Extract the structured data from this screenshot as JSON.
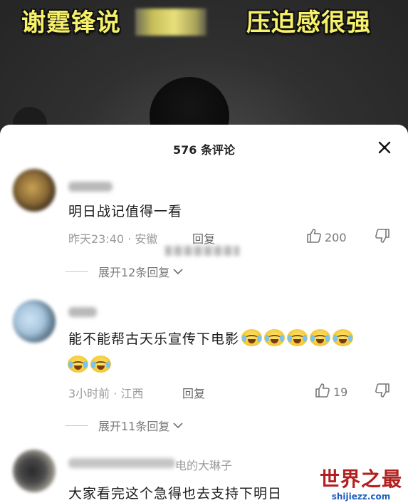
{
  "video": {
    "caption_left": "谢霆锋说",
    "caption_right": "压迫感很强"
  },
  "panel": {
    "title": "576 条评论",
    "close_icon": "close-icon"
  },
  "comments": [
    {
      "text": "明日战记值得一看",
      "time": "昨天23:40 · 安徽",
      "reply_label": "回复",
      "likes": "200",
      "expand_label": "展开12条回复"
    },
    {
      "text": "能不能帮古天乐宣传下电影",
      "time": "3小时前 · 江西",
      "reply_label": "回复",
      "likes": "19",
      "expand_label": "展开11条回复"
    },
    {
      "username_tail": "电的大琳子",
      "text": "大家看完这个急得也去支持下明日"
    }
  ],
  "watermark": {
    "title": "世界之最",
    "site": "shijiezz.com"
  },
  "colors": {
    "caption": "#f6f06a",
    "watermark_red": "#b32020",
    "watermark_blue": "#1f5fbf"
  }
}
